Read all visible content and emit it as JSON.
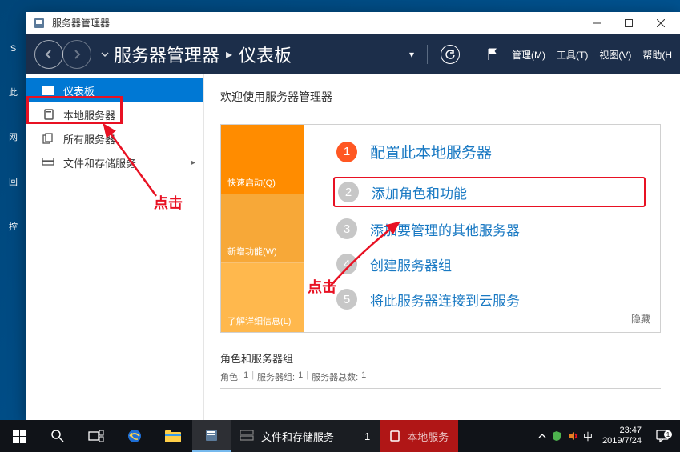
{
  "window": {
    "title": "服务器管理器"
  },
  "navbar": {
    "app": "服务器管理器",
    "page": "仪表板",
    "menu": [
      "管理(M)",
      "工具(T)",
      "视图(V)",
      "帮助(H"
    ]
  },
  "sidebar": {
    "items": [
      {
        "label": "仪表板"
      },
      {
        "label": "本地服务器"
      },
      {
        "label": "所有服务器"
      },
      {
        "label": "文件和存储服务"
      }
    ]
  },
  "content": {
    "welcome": "欢迎使用服务器管理器",
    "tiles": [
      {
        "label": "快速启动(Q)"
      },
      {
        "label": "新增功能(W)"
      },
      {
        "label": "了解详细信息(L)"
      }
    ],
    "steps": [
      {
        "num": "1",
        "text": "配置此本地服务器"
      },
      {
        "num": "2",
        "text": "添加角色和功能"
      },
      {
        "num": "3",
        "text": "添加要管理的其他服务器"
      },
      {
        "num": "4",
        "text": "创建服务器组"
      },
      {
        "num": "5",
        "text": "将此服务器连接到云服务"
      }
    ],
    "hide": "隐藏",
    "section2": {
      "title": "角色和服务器组",
      "sub1a": "角色:",
      "sub1b": "1",
      "sub2a": "服务器组:",
      "sub2b": "1",
      "sub3a": "服务器总数:",
      "sub3b": "1"
    }
  },
  "annotations": {
    "click": "点击"
  },
  "desktop": {
    "labels": [
      "S",
      "此",
      "网",
      "回",
      "控"
    ]
  },
  "taskbar": {
    "app1": "文件和存储服务",
    "app1_count": "1",
    "app2": "本地服务",
    "ime": "中",
    "time": "23:47",
    "date": "2019/7/24",
    "noti_count": "1"
  }
}
